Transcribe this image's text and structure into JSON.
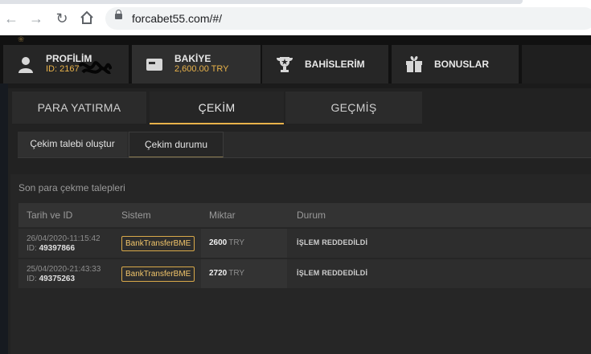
{
  "browser": {
    "url": "forcabet55.com/#/"
  },
  "topnav": {
    "profile": {
      "title": "PROFİLİM",
      "id": "ID: 2167"
    },
    "balance": {
      "title": "BAKİYE",
      "amount": "2,600.00 TRY"
    },
    "bets": {
      "title": "BAHİSLERİM"
    },
    "bonuses": {
      "title": "BONUSLAR"
    }
  },
  "subtabs": [
    {
      "label": "PARA YATIRMA"
    },
    {
      "label": "ÇEKİM"
    },
    {
      "label": "GEÇMİŞ"
    }
  ],
  "actions": {
    "create": "Çekim talebi oluştur",
    "status": "Çekim durumu"
  },
  "section": {
    "heading": "Son para çekme talepleri",
    "columns": [
      "Tarih ve ID",
      "Sistem",
      "Miktar",
      "Durum"
    ],
    "rows": [
      {
        "date": "26/04/2020-11:15:42",
        "id_prefix": "ID: ",
        "id": "49397866",
        "system": "BankTransferBME",
        "amount": "2600",
        "currency": "TRY",
        "status": "İŞLEM REDDEDİLDİ"
      },
      {
        "date": "25/04/2020-21:43:33",
        "id_prefix": "ID: ",
        "id": "49375263",
        "system": "BankTransferBME",
        "amount": "2720",
        "currency": "TRY",
        "status": "İŞLEM REDDEDİLDİ"
      }
    ]
  },
  "colors": {
    "accent": "#e8b24a",
    "background": "#1b1b1b"
  }
}
